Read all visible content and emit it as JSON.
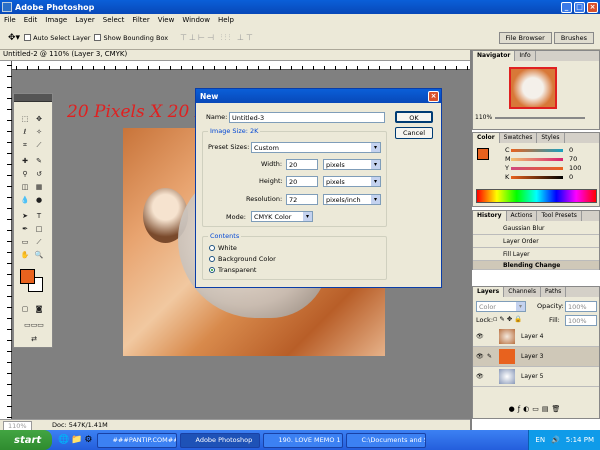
{
  "app": {
    "title": "Adobe Photoshop",
    "icon": "photoshop-icon"
  },
  "menu": [
    "File",
    "Edit",
    "Image",
    "Layer",
    "Select",
    "Filter",
    "View",
    "Window",
    "Help"
  ],
  "options": {
    "auto_select": "Auto Select Layer",
    "show_bounding": "Show Bounding Box",
    "well_tabs": [
      "File Browser",
      "Brushes"
    ]
  },
  "document": {
    "title": "Untitled-2 @ 110% (Layer 3, CMYK)",
    "zoom": "110%",
    "doc_info": "Doc: 547K/1.41M"
  },
  "canvas_note": "20 Pixels X 20 Pixels",
  "dialog": {
    "title": "New",
    "name_label": "Name:",
    "name_value": "Untitled-3",
    "image_size": "Image Size: 2K",
    "preset_label": "Preset Sizes:",
    "preset_value": "Custom",
    "width_label": "Width:",
    "width_value": "20",
    "width_unit": "pixels",
    "height_label": "Height:",
    "height_value": "20",
    "height_unit": "pixels",
    "res_label": "Resolution:",
    "res_value": "72",
    "res_unit": "pixels/inch",
    "mode_label": "Mode:",
    "mode_value": "CMYK Color",
    "contents": "Contents",
    "options": [
      "White",
      "Background Color",
      "Transparent"
    ],
    "selected": "Transparent",
    "ok": "OK",
    "cancel": "Cancel"
  },
  "navigator": {
    "tabs": [
      "Navigator",
      "Info"
    ],
    "zoom": "110%"
  },
  "color": {
    "tabs": [
      "Color",
      "Swatches",
      "Styles"
    ],
    "channels": [
      {
        "ch": "C",
        "val": "0"
      },
      {
        "ch": "M",
        "val": "70"
      },
      {
        "ch": "Y",
        "val": "100"
      },
      {
        "ch": "K",
        "val": "0"
      }
    ],
    "fg": "#e8621e"
  },
  "history": {
    "tabs": [
      "History",
      "Actions",
      "Tool Presets"
    ],
    "items": [
      "Gaussian Blur",
      "Layer Order",
      "Fill Layer",
      "Blending Change"
    ]
  },
  "layers": {
    "tabs": [
      "Layers",
      "Channels",
      "Paths"
    ],
    "mode": "Color",
    "opacity_label": "Opacity:",
    "opacity": "100%",
    "lock": "Lock:",
    "fill_label": "Fill:",
    "fill": "100%",
    "items": [
      "Layer 4",
      "Layer 3",
      "Layer 5"
    ]
  },
  "taskbar": {
    "start": "start",
    "tasks": [
      "###PANTIP.COM##...",
      "Adobe Photoshop",
      "190. LOVE MEMO 1 - ...",
      "C:\\Documents and Se..."
    ],
    "lang": "EN",
    "time": "5:14 PM"
  }
}
